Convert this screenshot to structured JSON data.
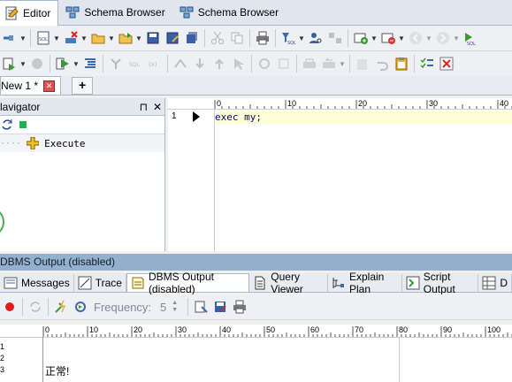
{
  "window_tabs": [
    "Editor",
    "Schema Browser",
    "Schema Browser"
  ],
  "doc_tab": {
    "label": "New 1 *",
    "new_tab_label": "+"
  },
  "navigator": {
    "title": "lavigator",
    "item": "Execute",
    "pin": "⊓",
    "close": "✕"
  },
  "editor": {
    "ruler_ticks": [
      "0",
      "10",
      "20",
      "30",
      "40"
    ],
    "line_number": "1",
    "code": "exec my;"
  },
  "output": {
    "panel_title": "DBMS Output (disabled)",
    "tabs": [
      "Messages",
      "Trace",
      "DBMS Output (disabled)",
      "Query Viewer",
      "Explain Plan",
      "Script Output",
      "D"
    ],
    "frequency_label": "Frequency:",
    "frequency_value": "5",
    "ruler_ticks": [
      "0",
      "10",
      "20",
      "30",
      "40",
      "50",
      "60",
      "70",
      "80",
      "90",
      "100"
    ],
    "line_numbers": [
      "1",
      "2",
      "3"
    ],
    "text": "正常!"
  },
  "colors": {
    "accent": "#95b0cc",
    "current_line": "#ffffd6",
    "keyword": "#000080"
  }
}
